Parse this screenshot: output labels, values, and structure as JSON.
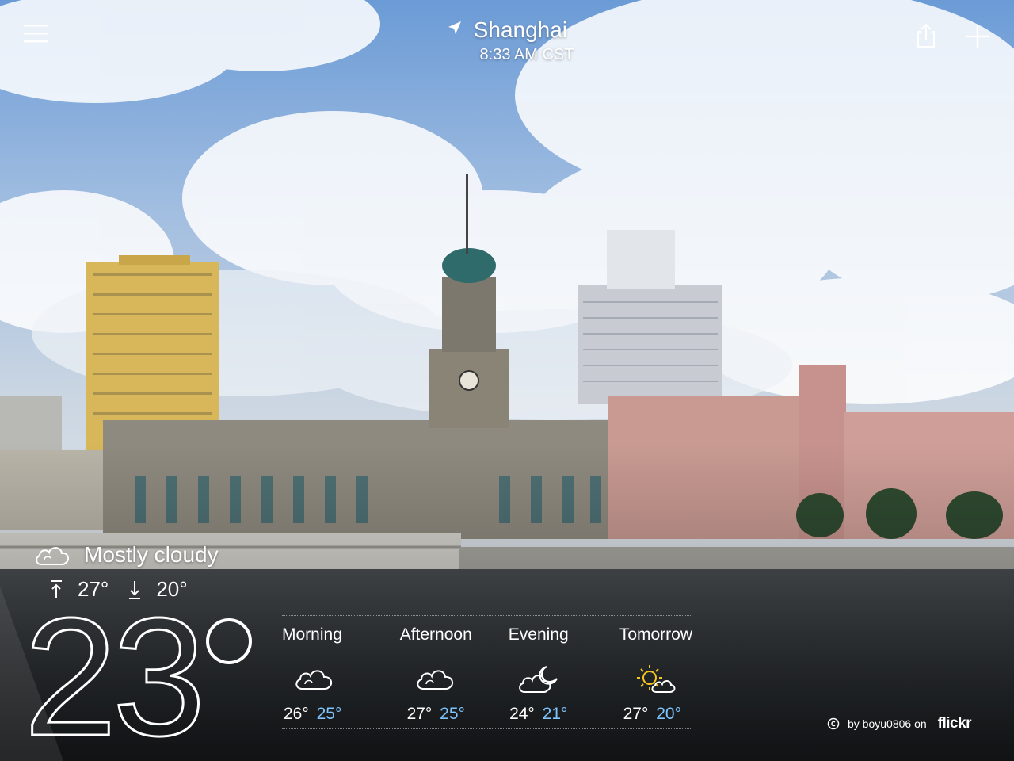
{
  "header": {
    "city": "Shanghai",
    "time": "8:33 AM CST",
    "icons": {
      "menu": "hamburger-menu-icon",
      "location": "location-arrow-icon",
      "share": "share-icon",
      "add": "add-icon"
    }
  },
  "current": {
    "condition": "Mostly cloudy",
    "condition_icon": "cloud-icon",
    "high": "27°",
    "low": "20°",
    "temp": "23"
  },
  "forecast": [
    {
      "label": "Morning",
      "icon": "cloud-icon",
      "high": "26°",
      "low": "25°"
    },
    {
      "label": "Afternoon",
      "icon": "cloud-icon",
      "high": "27°",
      "low": "25°"
    },
    {
      "label": "Evening",
      "icon": "moon-cloud-icon",
      "high": "24°",
      "low": "21°"
    },
    {
      "label": "Tomorrow",
      "icon": "sun-cloud-icon",
      "high": "27°",
      "low": "20°"
    }
  ],
  "credit": {
    "by": "by boyu0806 on",
    "site": "flickr"
  },
  "colors": {
    "low_temp": "#7fc4ff",
    "sun": "#f7c520",
    "text": "#ffffff"
  }
}
